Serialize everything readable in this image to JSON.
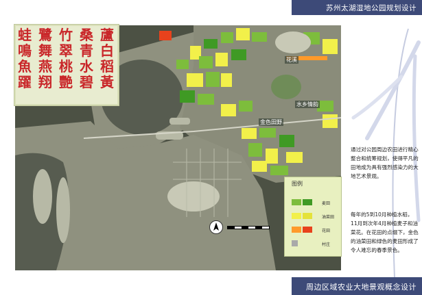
{
  "header": {
    "title": "苏州太湖湿地公园规划设计"
  },
  "footer": {
    "title": "周边区域农业大地景观概念设计"
  },
  "poster": {
    "columns": [
      [
        "蘆",
        "白",
        "稻",
        "黃"
      ],
      [
        "桑",
        "青",
        "水",
        "碧"
      ],
      [
        "竹",
        "翠",
        "桃",
        "艷"
      ],
      [
        "鷺",
        "舞",
        "燕",
        "翔"
      ],
      [
        "蛙",
        "鳴",
        "魚",
        "躍"
      ]
    ]
  },
  "map": {
    "labels": {
      "huaxi": "花溪",
      "shuixiang": "水乡情韵",
      "jinse": "金色田野"
    }
  },
  "legend": {
    "title": "图例",
    "items": [
      {
        "label": "麦田",
        "colors": [
          "#7dbd3c",
          "#3f9a24"
        ]
      },
      {
        "label": "油菜田",
        "colors": [
          "#f2f04a",
          "#e4e23a"
        ]
      },
      {
        "label": "花田",
        "colors": [
          "#ff9a2a",
          "#e8421c"
        ]
      },
      {
        "label": "村庄",
        "colors": [
          "#a9a9a9"
        ]
      }
    ]
  },
  "description": {
    "p1": "通过对公园周边农田进行精心整合和统筹规划，使得平凡的田地成为具有强烈感染力的大地艺术景观。",
    "p2": "每年的5到10月种植水稻，11月到次年4月种植麦子和油菜花。在花田的点缀下，金色的油菜田和绿色的麦田形成了令人难忘的春季景色。"
  },
  "compass": {
    "letter": "N"
  },
  "colors": {
    "bar": "#3d4a78",
    "poster_text": "#c9272a",
    "water": "#4c5144",
    "land": "#8f917f",
    "wheat": "#7dbd3c",
    "rape": "#f2f04a"
  }
}
